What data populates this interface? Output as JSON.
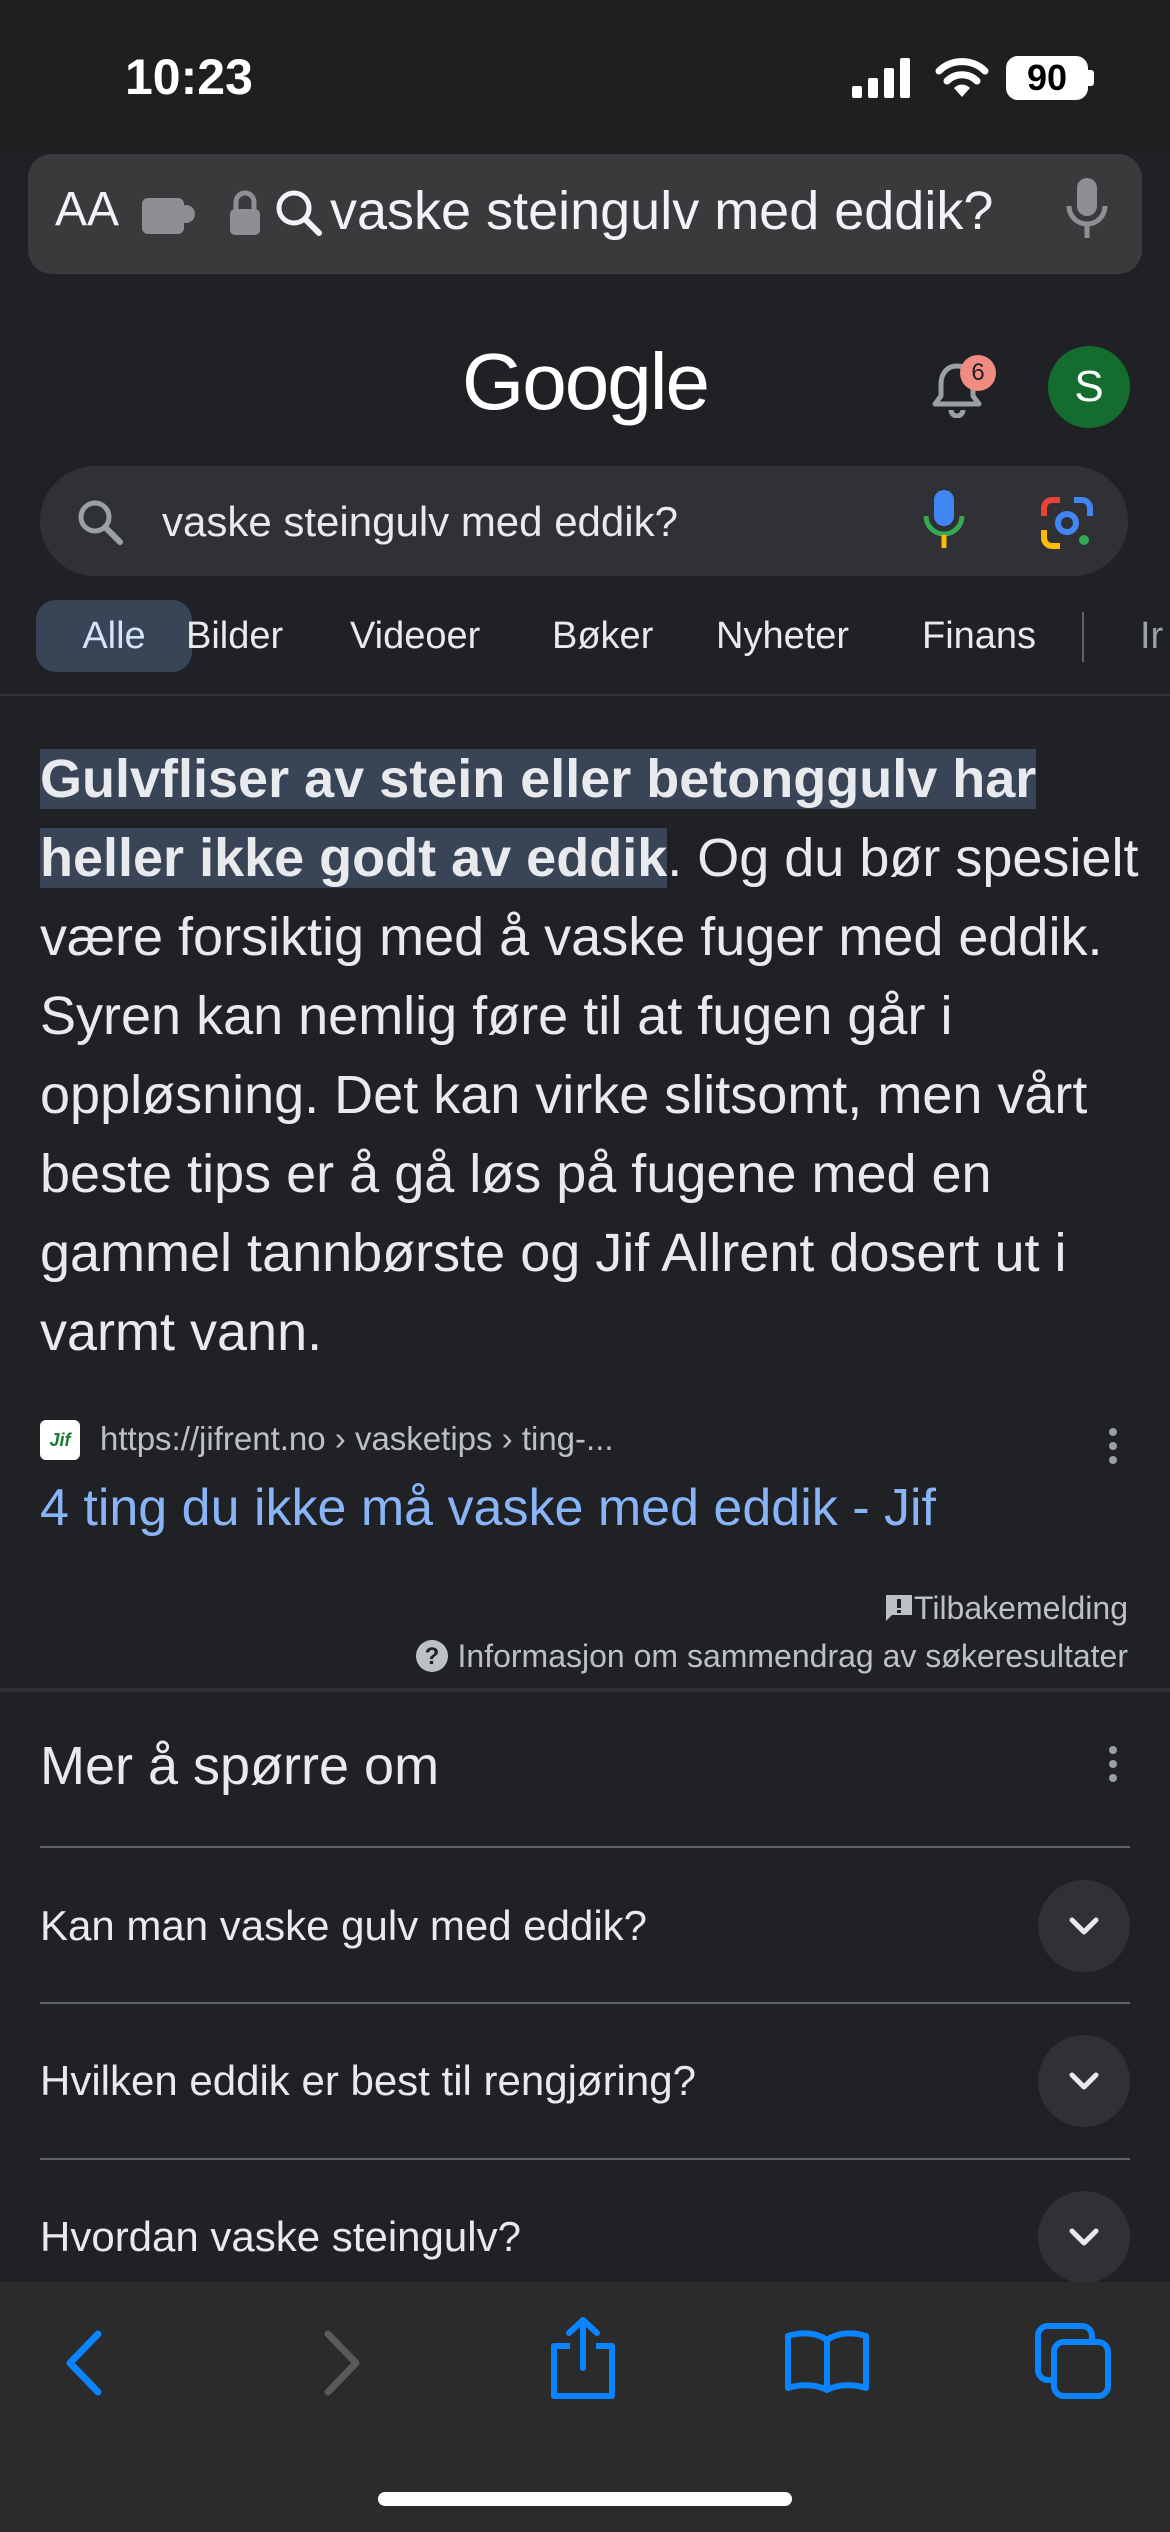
{
  "status": {
    "time": "10:23",
    "battery": "90"
  },
  "address_bar": {
    "aa": "AA",
    "text": "vaske steingulv med eddik?"
  },
  "google": {
    "logo": "Google",
    "notification_count": "6",
    "avatar_letter": "S",
    "search_value": "vaske steingulv med eddik?"
  },
  "tabs": [
    {
      "label": "Alle"
    },
    {
      "label": "Bilder"
    },
    {
      "label": "Videoer"
    },
    {
      "label": "Bøker"
    },
    {
      "label": "Nyheter"
    },
    {
      "label": "Finans"
    },
    {
      "label": "Ir"
    }
  ],
  "snippet": {
    "highlight": "Gulvfliser av stein eller betonggulv har heller ikke godt av eddik",
    "rest": ". Og du bør spesielt være forsiktig med å vaske fuger med eddik. Syren kan nemlig føre til at fugen går i oppløsning. Det kan virke slitsomt, men vårt beste tips er å gå løs på fugene med en gammel tannbørste og Jif Allrent dosert ut i varmt vann.",
    "source_icon_text": "Jif",
    "source_url": "https://jifrent.no › vasketips › ting-...",
    "source_title": "4 ting du ikke må vaske med eddik - Jif",
    "feedback": "Tilbakemelding",
    "info": "Informasjon om sammendrag av søkeresultater"
  },
  "paa": {
    "title": "Mer å spørre om",
    "questions": [
      "Kan man vaske gulv med eddik?",
      "Hvilken eddik er best til rengjøring?",
      "Hvordan vaske steingulv?"
    ]
  },
  "colors": {
    "link": "#8ab4f8",
    "highlight_bg": "#394457",
    "safari_blue": "#0a84ff"
  }
}
